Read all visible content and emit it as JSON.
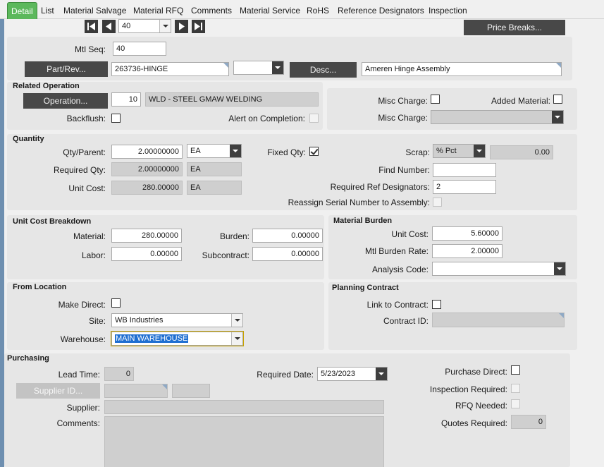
{
  "tabs": [
    {
      "label": "Detail",
      "active": true
    },
    {
      "label": "List"
    },
    {
      "label": "Material Salvage"
    },
    {
      "label": "Material RFQ"
    },
    {
      "label": "Comments"
    },
    {
      "label": "Material Service"
    },
    {
      "label": "RoHS"
    },
    {
      "label": "Reference Designators"
    },
    {
      "label": "Inspection"
    }
  ],
  "nav": {
    "record": "40",
    "price_breaks_label": "Price Breaks..."
  },
  "header": {
    "mtl_seq_label": "Mtl Seq:",
    "mtl_seq": "40",
    "part_rev_button": "Part/Rev...",
    "part_value": "263736-HINGE",
    "rev_value": "",
    "desc_button": "Desc...",
    "desc_value": "Ameren Hinge Assembly"
  },
  "related_operation": {
    "title": "Related Operation",
    "operation_button": "Operation...",
    "operation_num": "10",
    "operation_desc": "WLD - STEEL GMAW WELDING",
    "backflush_label": "Backflush:",
    "alert_label": "Alert on Completion:"
  },
  "misc": {
    "misc_charge_label": "Misc Charge:",
    "added_material_label": "Added Material:",
    "misc_charge_label2": "Misc Charge:",
    "misc_charge_value": ""
  },
  "quantity": {
    "title": "Quantity",
    "qty_parent_label": "Qty/Parent:",
    "qty_parent": "2.00000000",
    "qty_uom": "EA",
    "required_qty_label": "Required Qty:",
    "required_qty": "2.00000000",
    "required_uom": "EA",
    "unit_cost_label": "Unit Cost:",
    "unit_cost": "280.00000",
    "unit_cost_uom": "EA",
    "fixed_qty_label": "Fixed Qty:",
    "fixed_qty_checked": true,
    "scrap_label": "Scrap:",
    "scrap_type": "% Pct",
    "scrap_value": "0.00",
    "find_number_label": "Find Number:",
    "find_number": "",
    "req_ref_label": "Required Ref Designators:",
    "req_ref": "2",
    "reassign_label": "Reassign Serial Number to Assembly:"
  },
  "unit_cost_breakdown": {
    "title": "Unit Cost Breakdown",
    "material_label": "Material:",
    "material": "280.00000",
    "labor_label": "Labor:",
    "labor": "0.00000",
    "burden_label": "Burden:",
    "burden": "0.00000",
    "subcontract_label": "Subcontract:",
    "subcontract": "0.00000"
  },
  "material_burden": {
    "title": "Material Burden",
    "unit_cost_label": "Unit Cost:",
    "unit_cost": "5.60000",
    "rate_label": "Mtl  Burden Rate:",
    "rate": "2.00000",
    "analysis_label": "Analysis Code:",
    "analysis": ""
  },
  "from_location": {
    "title": "From Location",
    "make_direct_label": "Make Direct:",
    "site_label": "Site:",
    "site": "WB Industries",
    "warehouse_label": "Warehouse:",
    "warehouse": "MAIN WAREHOUSE"
  },
  "planning_contract": {
    "title": "Planning Contract",
    "link_label": "Link to Contract:",
    "contract_id_label": "Contract ID:",
    "contract_id": ""
  },
  "purchasing": {
    "title": "Purchasing",
    "lead_time_label": "Lead Time:",
    "lead_time": "0",
    "required_date_label": "Required Date:",
    "required_date": "5/23/2023",
    "supplier_id_button": "Supplier ID...",
    "supplier_label": "Supplier:",
    "comments_label": "Comments:",
    "purchase_direct_label": "Purchase Direct:",
    "inspection_required_label": "Inspection  Required:",
    "rfq_needed_label": "RFQ Needed:",
    "quotes_required_label": "Quotes Required:",
    "quotes_required": "0"
  }
}
